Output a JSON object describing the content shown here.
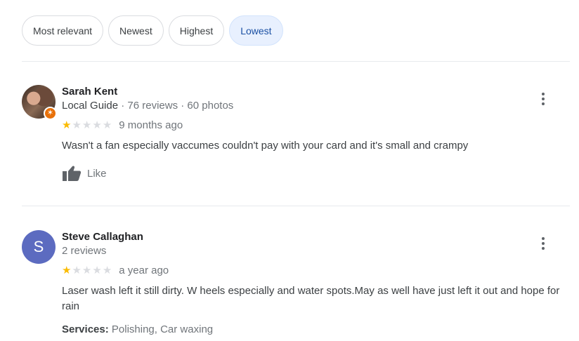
{
  "filters": [
    {
      "label": "Most relevant",
      "selected": false
    },
    {
      "label": "Newest",
      "selected": false
    },
    {
      "label": "Highest",
      "selected": false
    },
    {
      "label": "Lowest",
      "selected": true
    }
  ],
  "reviews": [
    {
      "author": "Sarah Kent",
      "badge": "Local Guide",
      "stats": " · 76 reviews · 60 photos",
      "rating": 1,
      "time": "9 months ago",
      "text": "Wasn't a fan especially vaccumes couldn't pay with your card and it's small and crampy",
      "like_label": "Like",
      "avatar_icon": "profile-photo"
    },
    {
      "author": "Steve Callaghan",
      "stats": "2 reviews",
      "rating": 1,
      "time": "a year ago",
      "text": "Laser wash  left it still dirty. W heels especially and water spots.May as well have just left it out and hope for rain",
      "services_label": "Services:",
      "services": "Polishing, Car waxing",
      "avatar_letter": "S"
    }
  ],
  "colors": {
    "star_filled": "#fbbc04",
    "star_empty": "#dadce0",
    "chip_selected_bg": "#e8f0fe",
    "avatar_letter_bg": "#5c6bc0",
    "guide_badge": "#e8710a"
  }
}
